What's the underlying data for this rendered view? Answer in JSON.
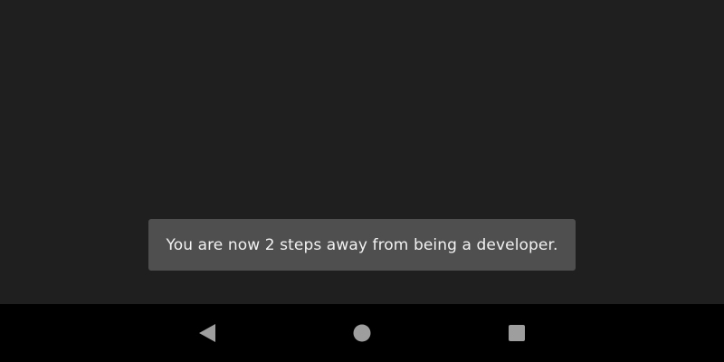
{
  "toast": {
    "message": "You are now 2 steps away from being a developer."
  },
  "navigation_bar": {
    "buttons": [
      {
        "name": "back",
        "icon": "back-triangle-icon"
      },
      {
        "name": "home",
        "icon": "home-circle-icon"
      },
      {
        "name": "recents",
        "icon": "recents-square-icon"
      }
    ]
  },
  "colors": {
    "background": "#1f1f1f",
    "toast_background": "#4f4f4f",
    "toast_text": "#f2f2f2",
    "navbar_background": "#000000",
    "navbar_icons": "#9e9e9e"
  }
}
